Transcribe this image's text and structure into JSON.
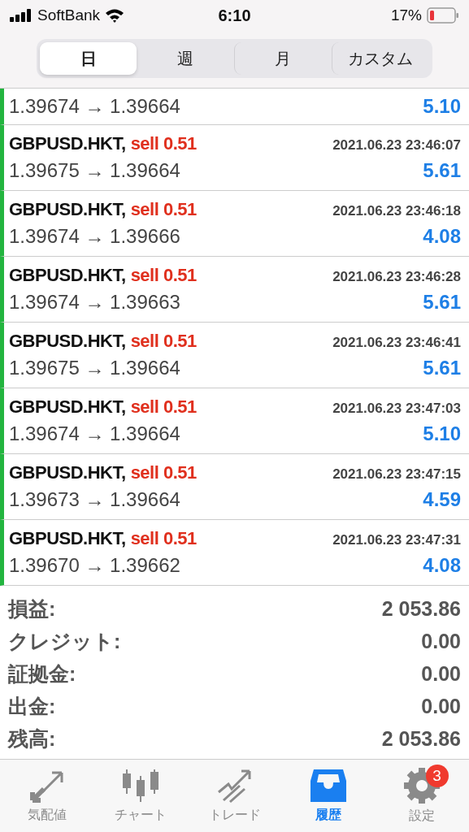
{
  "status_bar": {
    "carrier": "SoftBank",
    "time": "6:10",
    "battery": "17%"
  },
  "periods": [
    {
      "label": "日",
      "selected": true
    },
    {
      "label": "週",
      "selected": false
    },
    {
      "label": "月",
      "selected": false
    },
    {
      "label": "カスタム",
      "selected": false
    }
  ],
  "trades": [
    {
      "prices": "1.39674 → 1.39664",
      "profit": "5.10"
    },
    {
      "symbol": "GBPUSD.HKT,",
      "side": "sell 0.51",
      "time": "2021.06.23 23:46:07",
      "prices": "1.39675 → 1.39664",
      "profit": "5.61"
    },
    {
      "symbol": "GBPUSD.HKT,",
      "side": "sell 0.51",
      "time": "2021.06.23 23:46:18",
      "prices": "1.39674 → 1.39666",
      "profit": "4.08"
    },
    {
      "symbol": "GBPUSD.HKT,",
      "side": "sell 0.51",
      "time": "2021.06.23 23:46:28",
      "prices": "1.39674 → 1.39663",
      "profit": "5.61"
    },
    {
      "symbol": "GBPUSD.HKT,",
      "side": "sell 0.51",
      "time": "2021.06.23 23:46:41",
      "prices": "1.39675 → 1.39664",
      "profit": "5.61"
    },
    {
      "symbol": "GBPUSD.HKT,",
      "side": "sell 0.51",
      "time": "2021.06.23 23:47:03",
      "prices": "1.39674 → 1.39664",
      "profit": "5.10"
    },
    {
      "symbol": "GBPUSD.HKT,",
      "side": "sell 0.51",
      "time": "2021.06.23 23:47:15",
      "prices": "1.39673 → 1.39664",
      "profit": "4.59"
    },
    {
      "symbol": "GBPUSD.HKT,",
      "side": "sell 0.51",
      "time": "2021.06.23 23:47:31",
      "prices": "1.39670 → 1.39662",
      "profit": "4.08"
    }
  ],
  "summary": [
    {
      "label": "損益:",
      "value": "2 053.86"
    },
    {
      "label": "クレジット:",
      "value": "0.00"
    },
    {
      "label": "証拠金:",
      "value": "0.00"
    },
    {
      "label": "出金:",
      "value": "0.00"
    },
    {
      "label": "残高:",
      "value": "2 053.86"
    }
  ],
  "tab_bar": [
    {
      "kind": "quotes",
      "label": "気配値",
      "selected": false
    },
    {
      "kind": "chart",
      "label": "チャート",
      "selected": false
    },
    {
      "kind": "trade",
      "label": "トレード",
      "selected": false
    },
    {
      "kind": "history",
      "label": "履歴",
      "selected": true
    },
    {
      "kind": "settings",
      "label": "設定",
      "selected": false,
      "badge": "3"
    }
  ]
}
